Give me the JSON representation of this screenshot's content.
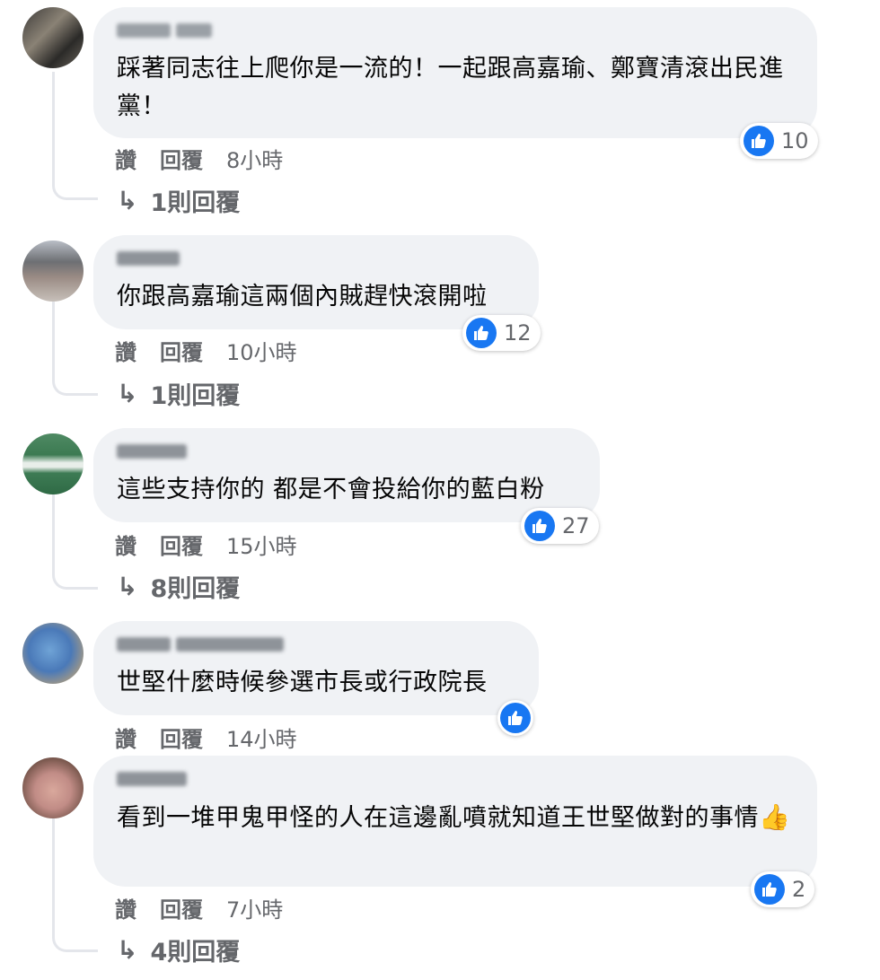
{
  "colors": {
    "like_blue": "#1877f2",
    "bubble_bg": "#f0f2f5",
    "meta_gray": "#65676b"
  },
  "comments": [
    {
      "text": "踩著同志往上爬你是一流的！一起跟高嘉瑜、鄭寶清滾出民進黨！",
      "reaction_count": "10",
      "actions": {
        "like": "讚",
        "reply": "回覆",
        "time": "8小時"
      },
      "replies": "1則回覆"
    },
    {
      "text": "你跟高嘉瑜這兩個內賊趕快滾開啦",
      "reaction_count": "12",
      "actions": {
        "like": "讚",
        "reply": "回覆",
        "time": "10小時"
      },
      "replies": "1則回覆"
    },
    {
      "text": "這些支持你的 都是不會投給你的藍白粉",
      "reaction_count": "27",
      "actions": {
        "like": "讚",
        "reply": "回覆",
        "time": "15小時"
      },
      "replies": "8則回覆"
    },
    {
      "text": "世堅什麼時候參選市長或行政院長",
      "reaction_count": "",
      "actions": {
        "like": "讚",
        "reply": "回覆",
        "time": "14小時"
      }
    },
    {
      "text": "看到一堆甲鬼甲怪的人在這邊亂噴就知道王世堅做對的事情",
      "emoji": "👍",
      "reaction_count": "2",
      "actions": {
        "like": "讚",
        "reply": "回覆",
        "time": "7小時"
      },
      "replies": "4則回覆"
    }
  ],
  "icons": {
    "like": "thumbs-up-icon",
    "reply_arrow": "reply-arrow-icon"
  },
  "reply_arrow_glyph": "↳"
}
